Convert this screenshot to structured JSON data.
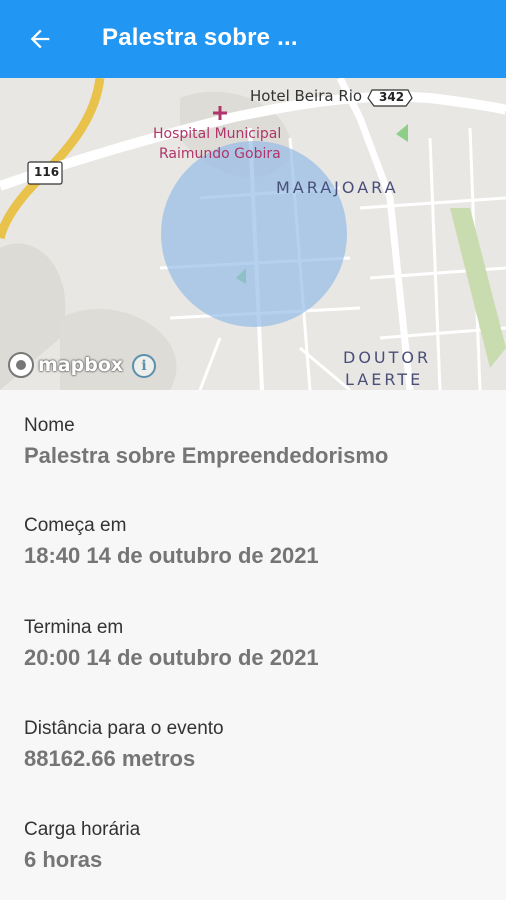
{
  "appbar": {
    "title": "Palestra sobre ...",
    "color": "#2196f3"
  },
  "map": {
    "labels": {
      "hotel": "Hotel Beira Rio",
      "road_342": "342",
      "road_116": "116",
      "hospital_line1": "Hospital Municipal",
      "hospital_line2": "Raimundo Gobira",
      "district_marajoara": "MARAJOARA",
      "district_doutor": "DOUTOR",
      "district_laerte": "LAERTE"
    },
    "attribution": "mapbox",
    "info_icon": "info-icon",
    "radius_color": "#8fb8e8"
  },
  "details": [
    {
      "label": "Nome",
      "value": "Palestra sobre Empreendedorismo"
    },
    {
      "label": "Começa em",
      "value": "18:40 14 de outubro de 2021"
    },
    {
      "label": "Termina em",
      "value": "20:00 14 de outubro de 2021"
    },
    {
      "label": "Distância para o evento",
      "value": "88162.66 metros"
    },
    {
      "label": "Carga horária",
      "value": "6 horas"
    }
  ]
}
